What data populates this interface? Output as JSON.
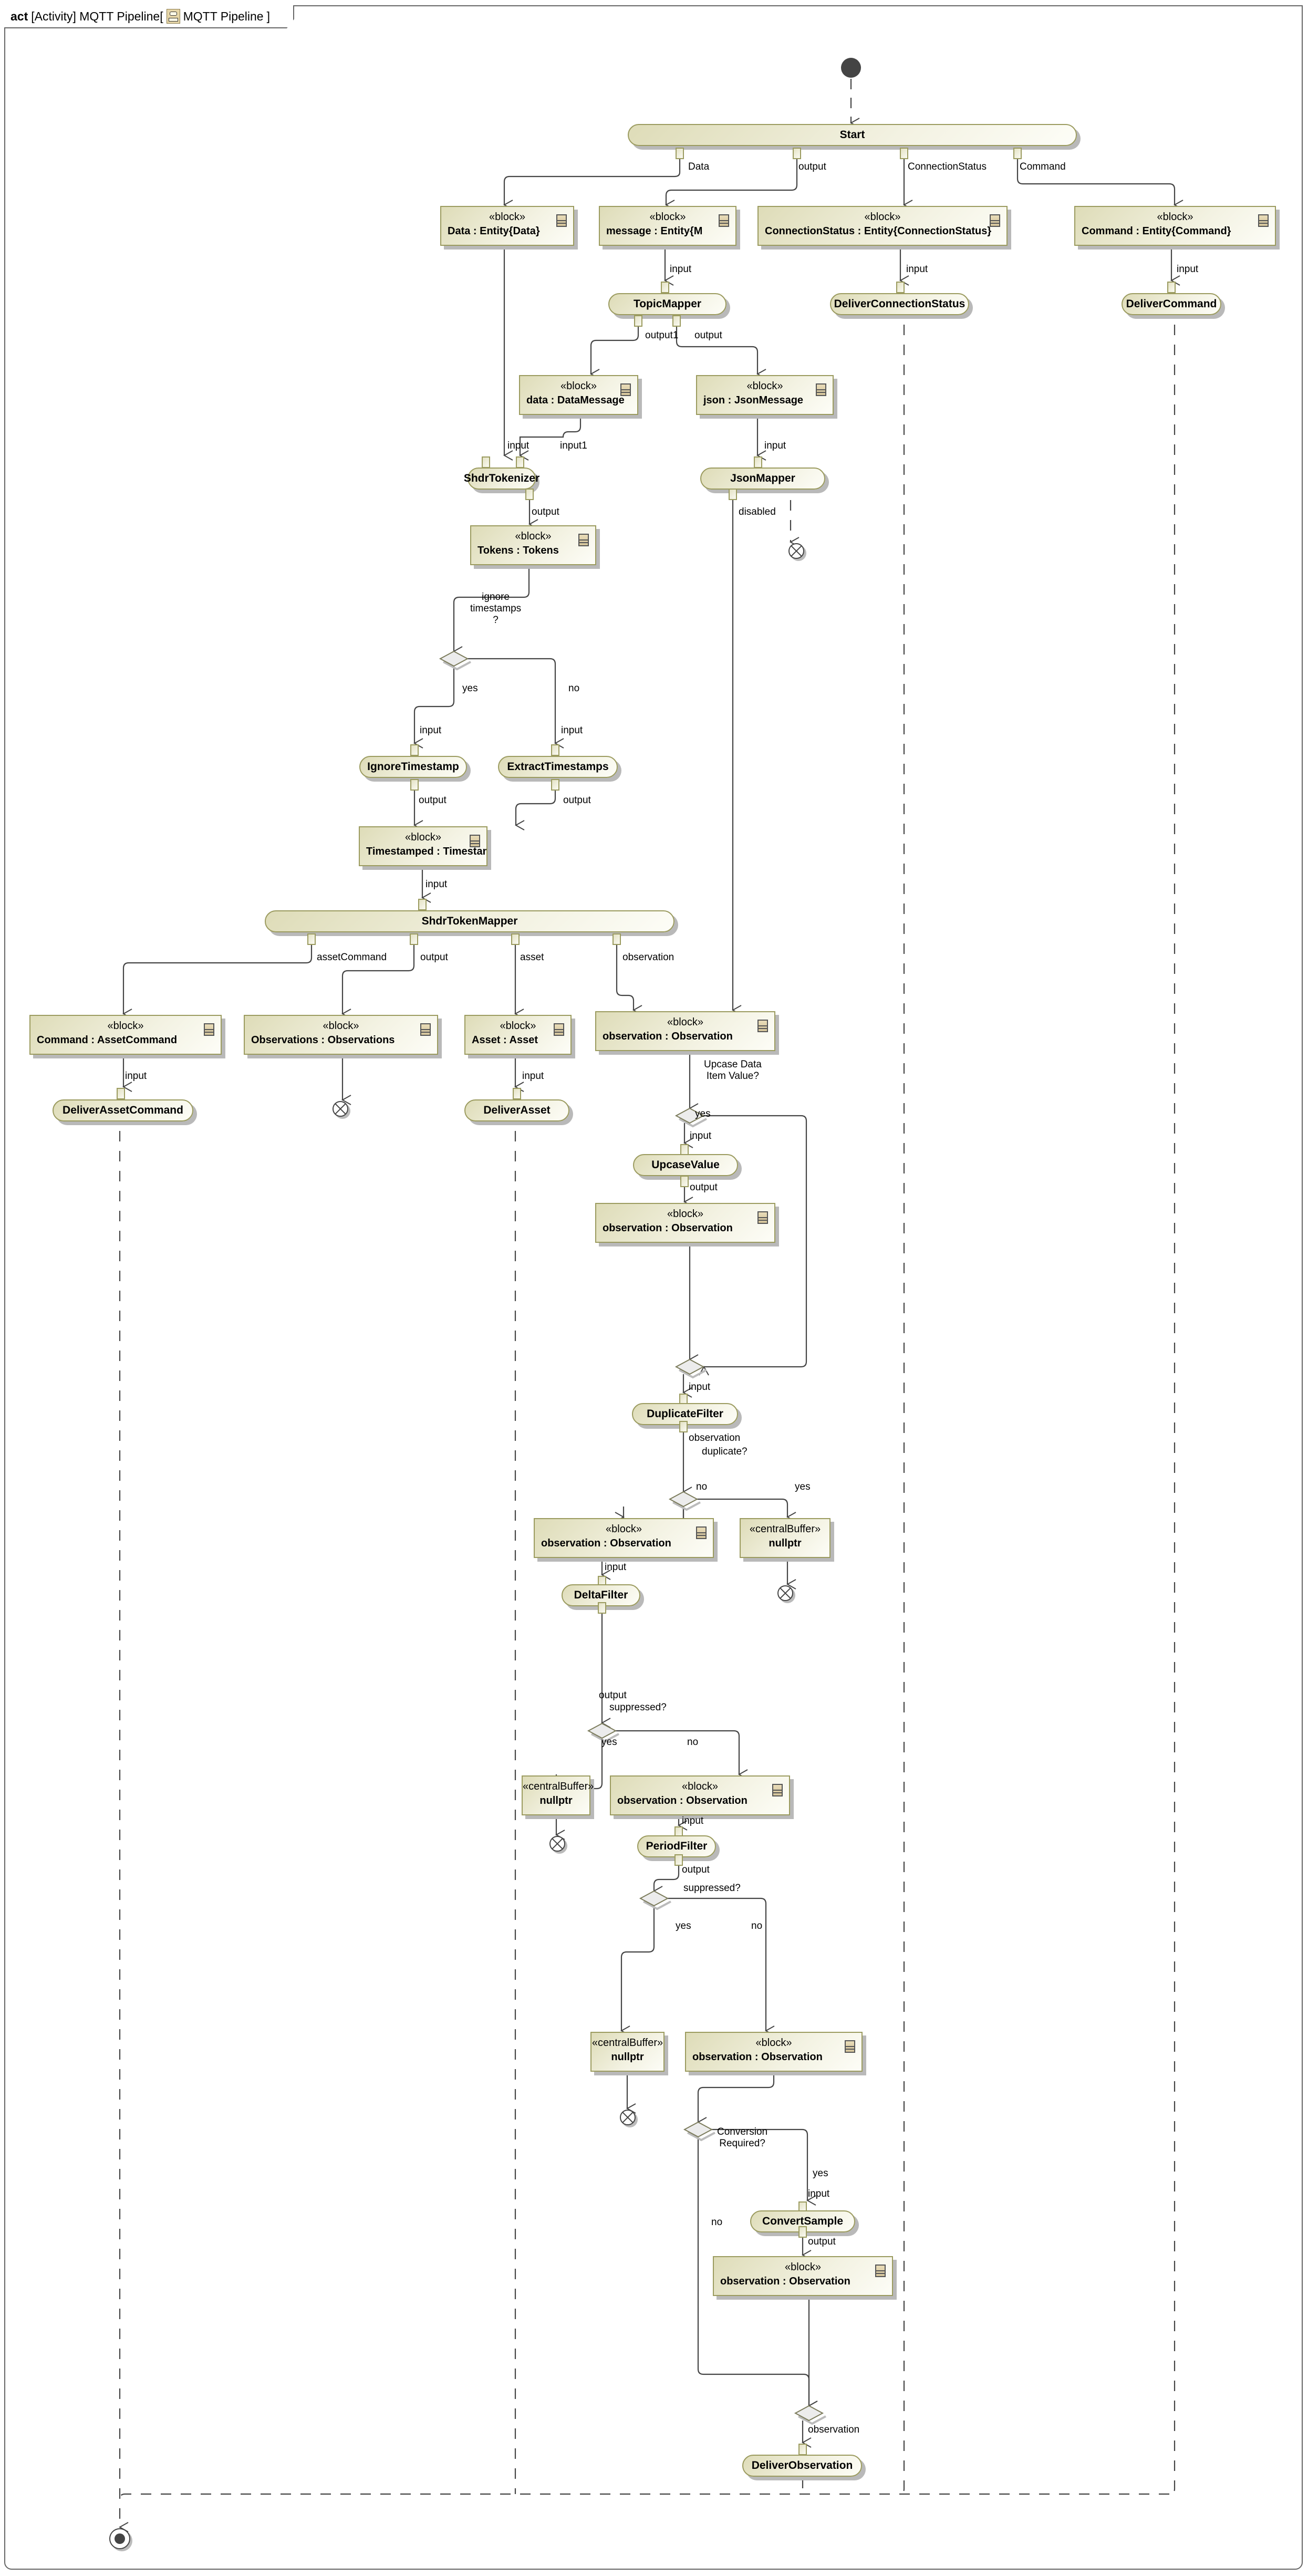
{
  "frame": {
    "kind": "act",
    "title": "[Activity] MQTT Pipeline[",
    "diagram_name": "MQTT Pipeline",
    "title_suffix": "]"
  },
  "actions": {
    "start": "Start",
    "topic_mapper": "TopicMapper",
    "deliver_connection_status": "DeliverConnectionStatus",
    "deliver_command": "DeliverCommand",
    "shdr_tokenizer": "ShdrTokenizer",
    "json_mapper": "JsonMapper",
    "ignore_timestamp": "IgnoreTimestamp",
    "extract_timestamps": "ExtractTimestamps",
    "shdr_token_mapper": "ShdrTokenMapper",
    "deliver_asset_command": "DeliverAssetCommand",
    "deliver_asset": "DeliverAsset",
    "upcase_value": "UpcaseValue",
    "duplicate_filter": "DuplicateFilter",
    "delta_filter": "DeltaFilter",
    "period_filter": "PeriodFilter",
    "convert_sample": "ConvertSample",
    "deliver_observation": "DeliverObservation"
  },
  "stereotypes": {
    "block": "«block»",
    "central_buffer": "«centralBuffer»"
  },
  "objects": {
    "data_entity": "Data : Entity{Data}",
    "message_entity": "message : Entity{M",
    "connection_status_entity": "ConnectionStatus : Entity{ConnectionStatus}",
    "command_entity": "Command : Entity{Command}",
    "data_message": "data : DataMessage",
    "json_message": "json : JsonMessage",
    "tokens": "Tokens : Tokens",
    "timestamped": "Timestamped : Timestamped",
    "asset_command": "Command : AssetCommand",
    "observations": "Observations : Observations",
    "asset": "Asset : Asset",
    "observation_1": "observation : Observation",
    "observation_2": "observation : Observation",
    "observation_3": "observation : Observation",
    "observation_4": "observation : Observation",
    "observation_5": "observation : Observation",
    "observation_6": "observation : Observation",
    "nullptr_1": "nullptr",
    "nullptr_2": "nullptr",
    "nullptr_3": "nullptr"
  },
  "edge_labels": {
    "data": "Data",
    "start_output": "output",
    "connection_status": "ConnectionStatus",
    "command": "Command",
    "topic_input": "input",
    "cs_input": "input",
    "cmd_input": "input",
    "output1": "output1",
    "topic_output": "output",
    "tok_input": "input",
    "tok_input1": "input1",
    "json_input": "input",
    "tok_output": "output",
    "disabled": "disabled",
    "ignore_timestamps_q": "ignore\ntimestamps\n?",
    "yes_1": "yes",
    "no_1": "no",
    "ignore_input": "input",
    "extract_input": "input",
    "ignore_output": "output",
    "extract_output": "output",
    "mapper_input": "input",
    "asset_command": "assetCommand",
    "mapper_output": "output",
    "asset": "asset",
    "observation": "observation",
    "dac_input": "input",
    "da_input": "input",
    "upcase_q": "Upcase Data\nItem Value?",
    "yes_2": "yes",
    "upcase_input": "input",
    "upcase_output": "output",
    "dup_input": "input",
    "dup_observation": "observation",
    "duplicate_q": "duplicate?",
    "no_3": "no",
    "yes_3": "yes",
    "delta_input": "input",
    "delta_output": "output",
    "suppressed_q_1": "suppressed?",
    "yes_4": "yes",
    "no_4": "no",
    "period_input": "input",
    "period_output": "output",
    "suppressed_q_2": "suppressed?",
    "yes_5": "yes",
    "no_5": "no",
    "conversion_q": "Conversion\nRequired?",
    "yes_6": "yes",
    "no_6": "no",
    "convert_input": "input",
    "convert_output": "output",
    "deliver_obs_input": "observation"
  }
}
